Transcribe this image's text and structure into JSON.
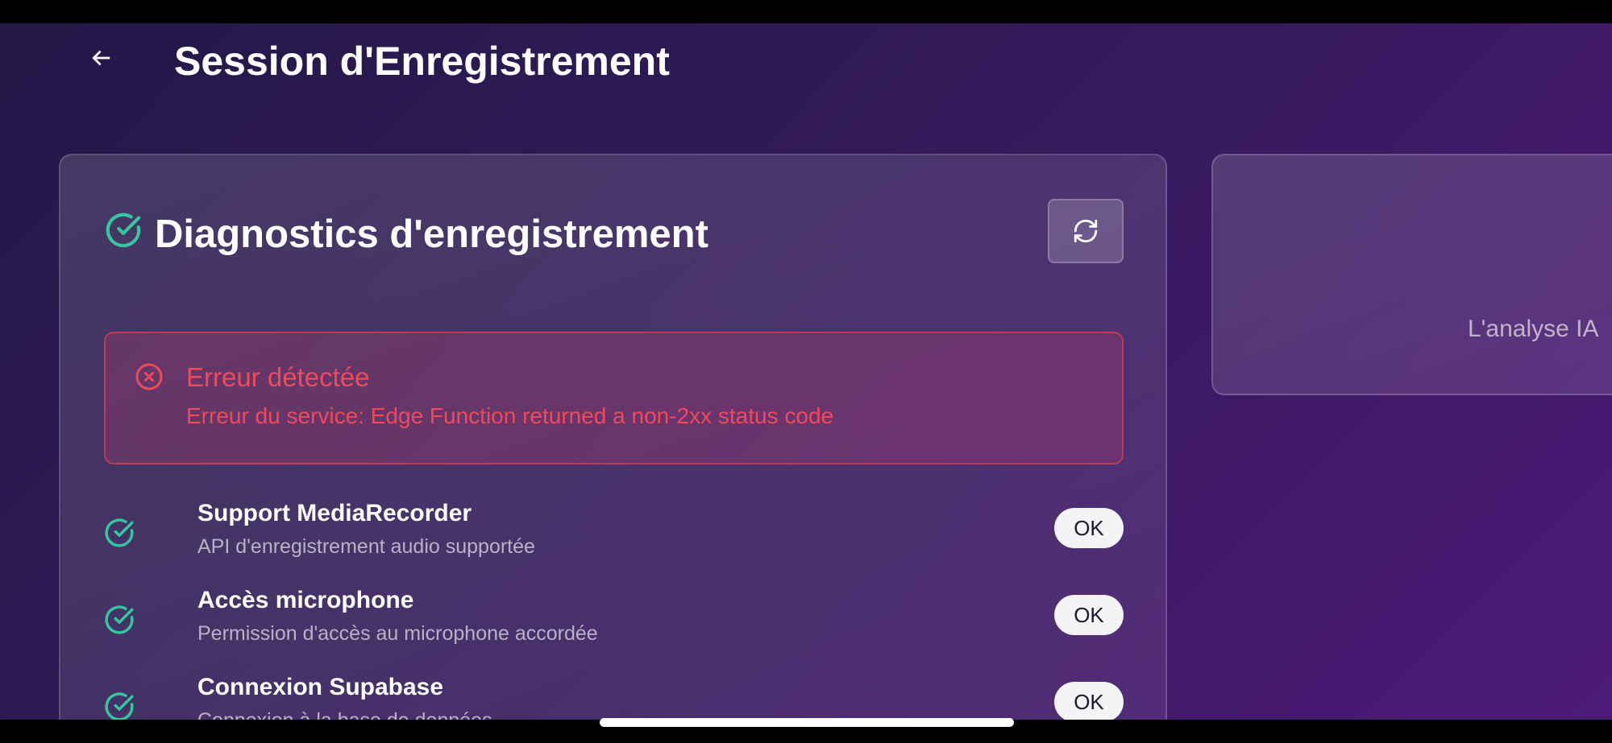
{
  "header": {
    "back_icon": "arrow-left-icon",
    "title": "Session d'Enregistrement"
  },
  "diagnostics": {
    "title_icon": "circle-check-icon",
    "title": "Diagnostics d'enregistrement",
    "refresh_icon": "refresh-icon",
    "error": {
      "icon": "circle-x-icon",
      "title": "Erreur détectée",
      "message": "Erreur du service: Edge Function returned a non-2xx status code"
    },
    "checks": [
      {
        "icon": "circle-check-icon",
        "title": "Support MediaRecorder",
        "description": "API d'enregistrement audio supportée",
        "status": "OK"
      },
      {
        "icon": "circle-check-icon",
        "title": "Accès microphone",
        "description": "Permission d'accès au microphone accordée",
        "status": "OK"
      },
      {
        "icon": "circle-check-icon",
        "title": "Connexion Supabase",
        "description": "Connexion à la base de données",
        "status": "OK"
      }
    ]
  },
  "side_panel": {
    "text": "L'analyse IA"
  },
  "colors": {
    "accent_success": "#34c6a0",
    "accent_error": "#f04a5a",
    "background_start": "#241848",
    "background_end": "#4d1a78"
  }
}
